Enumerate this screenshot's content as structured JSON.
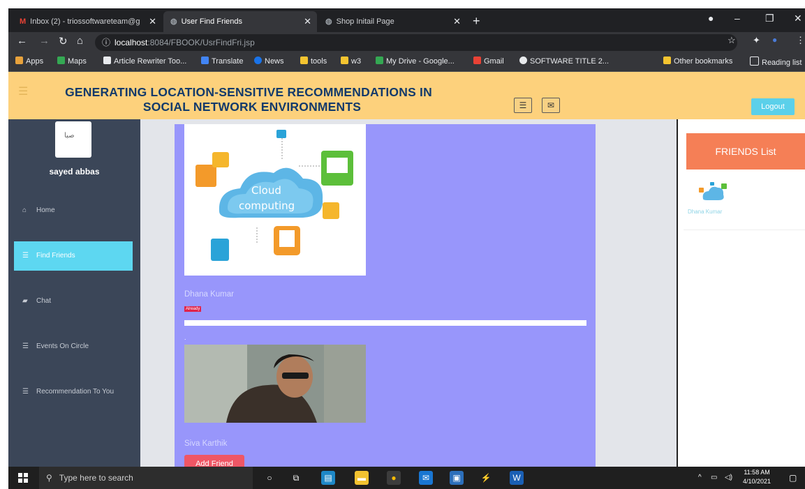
{
  "browser": {
    "tabs": [
      {
        "label": "Inbox (2) - triossoftwareteam@g",
        "icon": "gmail-icon",
        "active": false
      },
      {
        "label": "User Find Friends",
        "icon": "globe-icon",
        "active": true
      },
      {
        "label": "Shop Initail Page",
        "icon": "globe-icon",
        "active": false
      }
    ],
    "url_host": "localhost",
    "url_path": ":8084/FBOOK/UsrFindFri.jsp",
    "bookmarks": [
      "Apps",
      "Maps",
      "Article Rewriter Too...",
      "Translate",
      "News",
      "tools",
      "w3",
      "My Drive - Google...",
      "Gmail",
      "SOFTWARE TITLE 2...",
      "Other bookmarks",
      "Reading list"
    ]
  },
  "header": {
    "title_line1": "GENERATING LOCATION-SENSITIVE RECOMMENDATIONS IN",
    "title_line2": "SOCIAL NETWORK ENVIRONMENTS",
    "logout_label": "Logout"
  },
  "sidebar": {
    "avatar_text": "صبا",
    "username": "sayed abbas",
    "items": [
      {
        "label": "Home",
        "icon": "home-icon",
        "active": false
      },
      {
        "label": "Find Friends",
        "icon": "list-icon",
        "active": true
      },
      {
        "label": "Chat",
        "icon": "chat-icon",
        "active": false
      },
      {
        "label": "Events On Circle",
        "icon": "list-icon",
        "active": false
      },
      {
        "label": "Recommendation To You",
        "icon": "list-icon",
        "active": false
      }
    ]
  },
  "main": {
    "cards": [
      {
        "image_text_1": "Cloud",
        "image_text_2": "computing",
        "name": "Dhana Kumar",
        "badge": "Already"
      },
      {
        "name": "Siva Karthik",
        "button": "Add Friend"
      }
    ],
    "separator_dot": "."
  },
  "friends": {
    "header": "FRIENDS List",
    "items": [
      {
        "name": "Dhana Kumar"
      }
    ]
  },
  "taskbar": {
    "search_placeholder": "Type here to search",
    "time": "11:58 AM",
    "date": "4/10/2021"
  }
}
